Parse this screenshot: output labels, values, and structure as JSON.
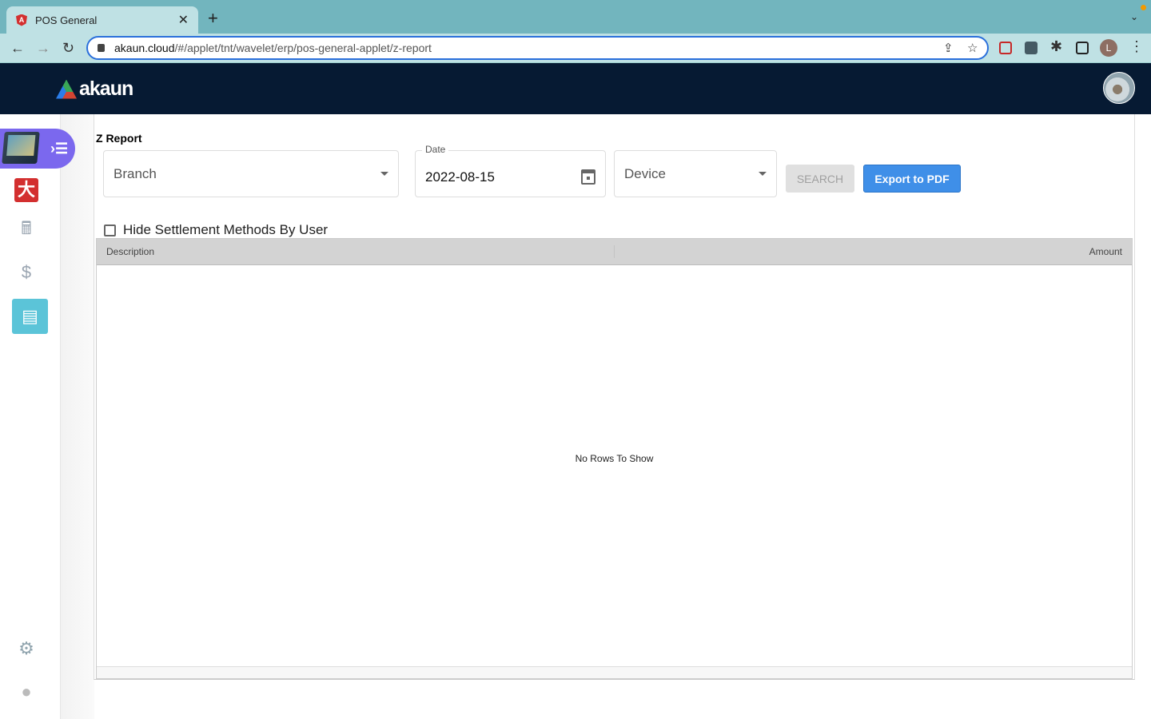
{
  "browser": {
    "tab_title": "POS General",
    "url_host": "akaun.cloud",
    "url_path": "/#/applet/tnt/wavelet/erp/pos-general-applet/z-report",
    "profile_initial": "L"
  },
  "app": {
    "logo_text": "akaun"
  },
  "sidebar": {
    "items": [
      {
        "icon": "pos-terminal-icon"
      },
      {
        "icon": "brand-app-icon"
      },
      {
        "icon": "cash-register-icon"
      },
      {
        "icon": "dollar-icon"
      },
      {
        "icon": "report-list-icon",
        "active": true
      },
      {
        "icon": "gear-icon"
      },
      {
        "icon": "user-icon"
      }
    ]
  },
  "page": {
    "title": "Z Report",
    "branch_placeholder": "Branch",
    "date_label": "Date",
    "date_value": "2022-08-15",
    "device_placeholder": "Device",
    "search_label": "SEARCH",
    "export_label": "Export to PDF",
    "hide_settlement_label": "Hide Settlement Methods By User",
    "hide_settlement_checked": false,
    "columns": [
      "Description",
      "Amount"
    ],
    "empty_message": "No Rows To Show"
  },
  "colors": {
    "appbar": "#061a33",
    "accent": "#7b68ee",
    "active": "#5bc4d8",
    "export": "#3f8fe8"
  }
}
